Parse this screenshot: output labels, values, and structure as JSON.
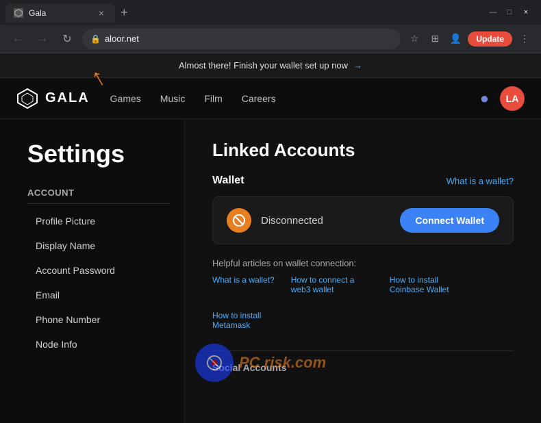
{
  "browser": {
    "tab": {
      "favicon": "G",
      "title": "Gala",
      "close_label": "×"
    },
    "new_tab_label": "+",
    "window_controls": {
      "minimize": "—",
      "maximize": "□",
      "close": "×"
    },
    "nav": {
      "back_disabled": true,
      "forward_disabled": true,
      "refresh_label": "↻"
    },
    "address": "aloor.net",
    "lock_icon": "🔒",
    "update_label": "Update"
  },
  "banner": {
    "text": "Almost there! Finish your wallet set up now",
    "link_label": "→"
  },
  "site_nav": {
    "logo_text": "GALA",
    "links": [
      "Games",
      "Music",
      "Film",
      "Careers"
    ],
    "avatar_initials": "LA"
  },
  "sidebar": {
    "page_title": "Settings",
    "section_title": "Account",
    "items": [
      {
        "label": "Profile Picture"
      },
      {
        "label": "Display Name"
      },
      {
        "label": "Account Password"
      },
      {
        "label": "Email"
      },
      {
        "label": "Phone Number"
      },
      {
        "label": "Node Info"
      }
    ]
  },
  "content": {
    "section_title": "Linked Accounts",
    "wallet": {
      "subtitle": "Wallet",
      "help_link": "What is a wallet?",
      "status": "Disconnected",
      "connect_button": "Connect Wallet"
    },
    "helpful": {
      "title": "Helpful articles on wallet connection:",
      "articles": [
        "What is a wallet?",
        "How to connect a web3 wallet",
        "How to install Coinbase Wallet",
        "How to install Metamask"
      ]
    },
    "social_section": "Social Accounts"
  },
  "icons": {
    "lock": "🔒",
    "wallet_emoji": "🔗",
    "discord": "💬",
    "star": "☆",
    "menu": "⋮"
  }
}
